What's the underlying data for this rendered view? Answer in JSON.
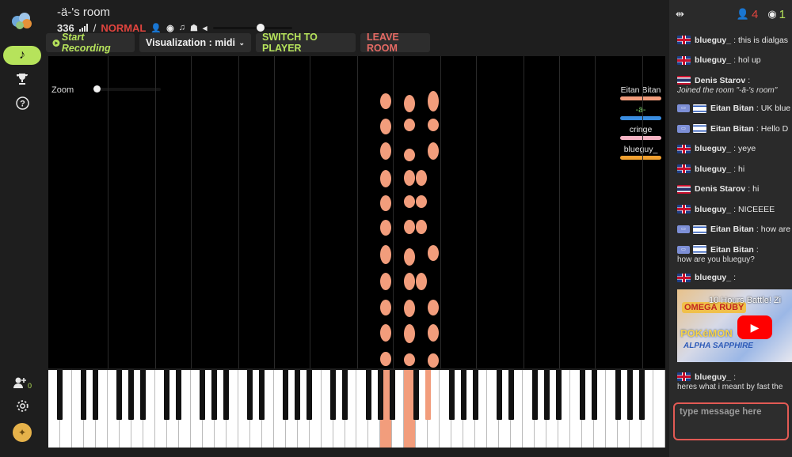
{
  "room": {
    "title": "-ä-'s room",
    "ping": "336",
    "divider": "/",
    "mode": "NORMAL"
  },
  "toolbar": {
    "record_label": "Start Recording",
    "visualization_label": "Visualization : midi",
    "switch_label": "SWITCH TO PLAYER",
    "leave_label": "LEAVE ROOM"
  },
  "stage": {
    "zoom_label": "Zoom",
    "players": [
      {
        "name": "Eitan Bitan",
        "color": "#f29d7c",
        "text_color": "#e8e8e8"
      },
      {
        "name": "-ä-",
        "color": "#3a8de0",
        "text_color": "#7fd36a"
      },
      {
        "name": "cringe",
        "color": "#f6b4c4",
        "text_color": "#e8e8e8"
      },
      {
        "name": "blueguy_",
        "color": "#f0a030",
        "text_color": "#e8e8e8"
      }
    ]
  },
  "sidebar": {
    "online_badge_count": "0"
  },
  "chat": {
    "user_count": "4",
    "viewer_count": "1",
    "messages": [
      {
        "flag": "gb",
        "user": "blueguy_",
        "text": "this is dialgas"
      },
      {
        "flag": "gb",
        "user": "blueguy_",
        "text": "hol up"
      },
      {
        "flag": "th",
        "user": "Denis Starov",
        "text": ""
      },
      {
        "flag": "il",
        "user": "Eitan Bitan",
        "text": "UK blue",
        "badge": true
      },
      {
        "flag": "il",
        "user": "Eitan Bitan",
        "text": "Hello D",
        "badge": true
      },
      {
        "flag": "gb",
        "user": "blueguy_",
        "text": "yeye"
      },
      {
        "flag": "gb",
        "user": "blueguy_",
        "text": "hi"
      },
      {
        "flag": "th",
        "user": "Denis Starov",
        "text": "hi"
      },
      {
        "flag": "gb",
        "user": "blueguy_",
        "text": "NICEEEE"
      },
      {
        "flag": "il",
        "user": "Eitan Bitan",
        "text": "how are",
        "badge": true
      },
      {
        "flag": "il",
        "user": "Eitan Bitan",
        "text": "",
        "badge": true
      },
      {
        "flag": "gb",
        "user": "blueguy_",
        "text": ""
      },
      {
        "flag": "gb",
        "user": "blueguy_",
        "text": ""
      }
    ],
    "denis_join_note": "Joined the room \"-ä-'s room\"",
    "eitan_followup": "how are you blueguy?",
    "last_followup": "heres what i meant by fast the",
    "video_title": "10 Hours Battle! Zi",
    "video_logo_top": "OMEGA RUBY",
    "video_logo_mid": "POKéMON",
    "video_logo_bottom": "ALPHA SAPPHIRE",
    "input_placeholder": "type message here"
  }
}
